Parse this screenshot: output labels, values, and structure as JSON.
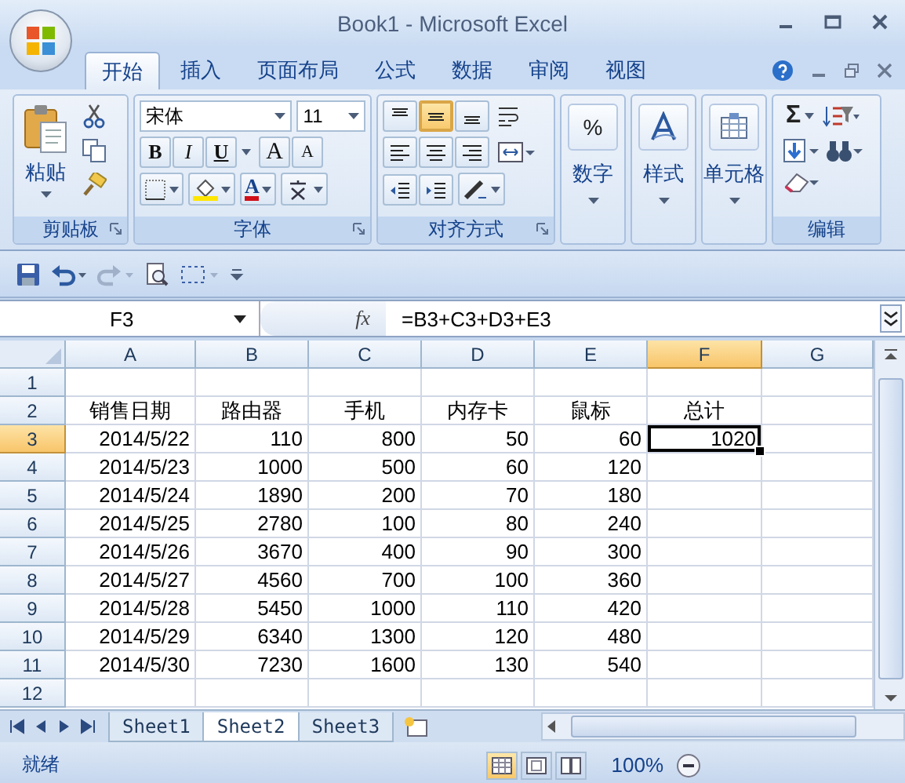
{
  "window": {
    "title": "Book1 - Microsoft Excel"
  },
  "ribbon_tabs": [
    {
      "label": "开始",
      "selected": true
    },
    {
      "label": "插入",
      "selected": false
    },
    {
      "label": "页面布局",
      "selected": false
    },
    {
      "label": "公式",
      "selected": false
    },
    {
      "label": "数据",
      "selected": false
    },
    {
      "label": "审阅",
      "selected": false
    },
    {
      "label": "视图",
      "selected": false
    }
  ],
  "ribbon_groups": [
    {
      "kind": "clipboard",
      "label": "剪贴板",
      "paste": "粘贴"
    },
    {
      "kind": "font",
      "label": "字体",
      "font_name": "宋体",
      "font_size": "11",
      "style_buttons": [
        "B",
        "I",
        "U"
      ],
      "size_buttons": [
        "A",
        "A"
      ],
      "font_color_button": "A"
    },
    {
      "kind": "alignment",
      "label": "对齐方式",
      "vertical": [
        {
          "selected": false
        },
        {
          "selected": true
        },
        {
          "selected": false
        }
      ]
    },
    {
      "kind": "number",
      "label": "数字",
      "symbol": "%"
    },
    {
      "kind": "styles",
      "label": "样式"
    },
    {
      "kind": "cells",
      "label": "单元格"
    },
    {
      "kind": "editing",
      "label": "编辑",
      "sum_symbol": "Σ"
    }
  ],
  "formula_bar": {
    "name_box": "F3",
    "function_label": "fx",
    "formula": "=B3+C3+D3+E3"
  },
  "columns": [
    {
      "label": "A",
      "selected": false
    },
    {
      "label": "B",
      "selected": false
    },
    {
      "label": "C",
      "selected": false
    },
    {
      "label": "D",
      "selected": false
    },
    {
      "label": "E",
      "selected": false
    },
    {
      "label": "F",
      "selected": true
    },
    {
      "label": "G",
      "selected": false
    }
  ],
  "rows": [
    {
      "number": "1",
      "selected": false,
      "kind": "empty"
    },
    {
      "number": "2",
      "selected": false,
      "kind": "header",
      "cells": [
        "销售日期",
        "路由器",
        "手机",
        "内存卡",
        "鼠标",
        "总计",
        null
      ]
    },
    {
      "number": "3",
      "selected": true,
      "kind": "data",
      "cells": [
        "2014/5/22",
        "110",
        "800",
        "50",
        "60",
        "1020",
        null
      ]
    },
    {
      "number": "4",
      "selected": false,
      "kind": "data",
      "cells": [
        "2014/5/23",
        "1000",
        "500",
        "60",
        "120",
        null,
        null
      ]
    },
    {
      "number": "5",
      "selected": false,
      "kind": "data",
      "cells": [
        "2014/5/24",
        "1890",
        "200",
        "70",
        "180",
        null,
        null
      ]
    },
    {
      "number": "6",
      "selected": false,
      "kind": "data",
      "cells": [
        "2014/5/25",
        "2780",
        "100",
        "80",
        "240",
        null,
        null
      ]
    },
    {
      "number": "7",
      "selected": false,
      "kind": "data",
      "cells": [
        "2014/5/26",
        "3670",
        "400",
        "90",
        "300",
        null,
        null
      ]
    },
    {
      "number": "8",
      "selected": false,
      "kind": "data",
      "cells": [
        "2014/5/27",
        "4560",
        "700",
        "100",
        "360",
        null,
        null
      ]
    },
    {
      "number": "9",
      "selected": false,
      "kind": "data",
      "cells": [
        "2014/5/28",
        "5450",
        "1000",
        "110",
        "420",
        null,
        null
      ]
    },
    {
      "number": "10",
      "selected": false,
      "kind": "data",
      "cells": [
        "2014/5/29",
        "6340",
        "1300",
        "120",
        "480",
        null,
        null
      ]
    },
    {
      "number": "11",
      "selected": false,
      "kind": "data",
      "cells": [
        "2014/5/30",
        "7230",
        "1600",
        "130",
        "540",
        null,
        null
      ]
    },
    {
      "number": "12",
      "selected": false,
      "kind": "empty"
    }
  ],
  "sheet_tabs": [
    {
      "label": "Sheet1",
      "selected": false
    },
    {
      "label": "Sheet2",
      "selected": true
    },
    {
      "label": "Sheet3",
      "selected": false
    }
  ],
  "status_bar": {
    "text": "就绪",
    "view_buttons": [
      {
        "selected": true
      },
      {
        "selected": false
      },
      {
        "selected": false
      }
    ],
    "zoom": "100%"
  }
}
